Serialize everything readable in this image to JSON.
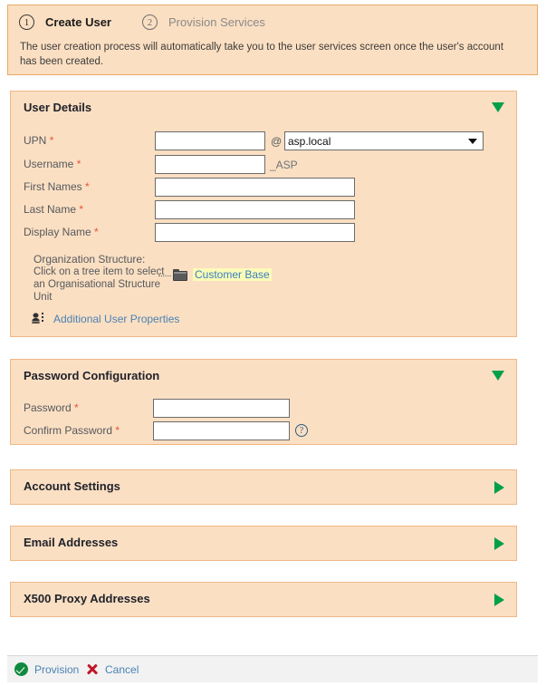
{
  "wizard": {
    "steps": [
      {
        "number": "1",
        "label": "Create User",
        "active": true
      },
      {
        "number": "2",
        "label": "Provision Services",
        "active": false
      }
    ],
    "description": "The user creation process will automatically take you to the user services screen once the user's account has been created."
  },
  "sections": {
    "user_details": {
      "title": "User Details",
      "toggle_icon": "chevron-down-icon",
      "fields": {
        "upn": {
          "label": "UPN",
          "required_marker": "*",
          "value": "",
          "at": "@"
        },
        "upn_domain": {
          "selected": "asp.local",
          "options": [
            "asp.local"
          ]
        },
        "username": {
          "label": "Username",
          "required_marker": "*",
          "value": "",
          "suffix": "_ASP"
        },
        "first_names": {
          "label": "First Names",
          "required_marker": "*",
          "value": ""
        },
        "last_name": {
          "label": "Last Name",
          "required_marker": "*",
          "value": ""
        },
        "display_name": {
          "label": "Display Name",
          "required_marker": "*",
          "value": ""
        }
      },
      "org_structure": {
        "title": "Organization Structure:",
        "hint": "Click on a tree item to select an Organisational Structure Unit",
        "tree_node": "Customer Base"
      },
      "additional_properties_link": "Additional User Properties"
    },
    "password_configuration": {
      "title": "Password Configuration",
      "toggle_icon": "chevron-down-icon",
      "fields": {
        "password": {
          "label": "Password",
          "required_marker": "*",
          "value": ""
        },
        "confirm_password": {
          "label": "Confirm Password",
          "required_marker": "*",
          "value": ""
        }
      },
      "help_icon": "?"
    },
    "account_settings": {
      "title": "Account Settings",
      "toggle_icon": "chevron-right-icon"
    },
    "email_addresses": {
      "title": "Email Addresses",
      "toggle_icon": "chevron-right-icon"
    },
    "x500_proxy_addresses": {
      "title": "X500 Proxy Addresses",
      "toggle_icon": "chevron-right-icon"
    }
  },
  "footer": {
    "provision_label": "Provision",
    "cancel_label": "Cancel"
  },
  "colors": {
    "panel_bg": "#fbdfc2",
    "panel_border": "#edb888",
    "accent_green": "#00a04a",
    "link_blue": "#4a82b4",
    "required_red": "#e0573e",
    "tree_highlight": "#fbfbb8"
  }
}
